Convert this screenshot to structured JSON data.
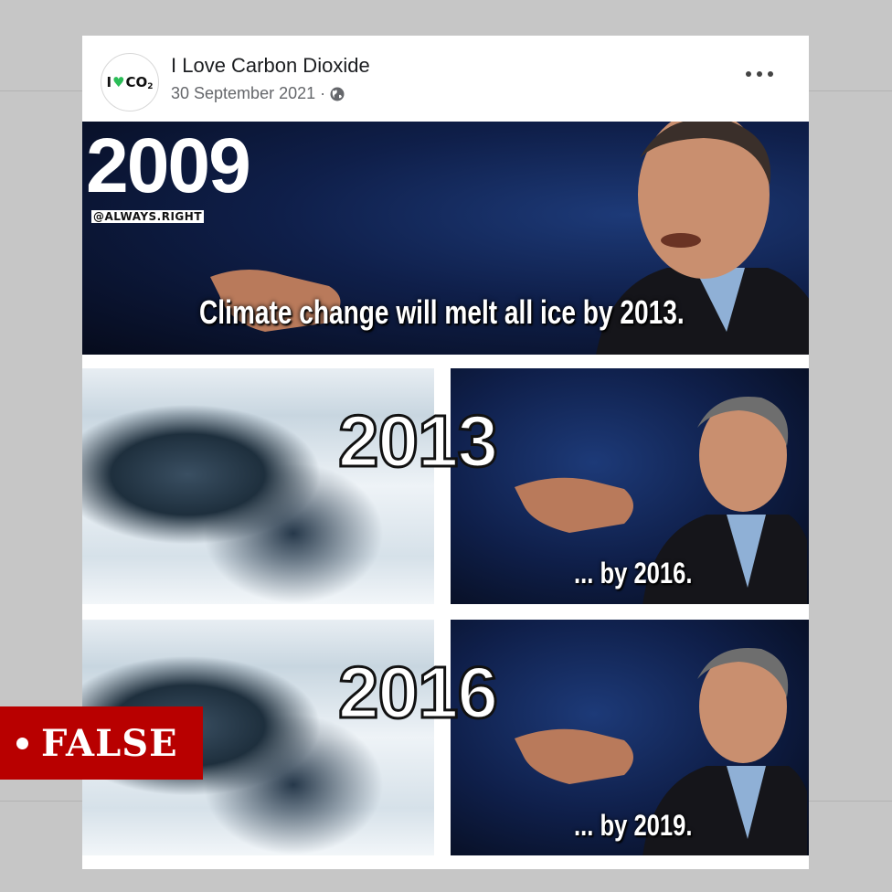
{
  "post": {
    "avatar_text": "I",
    "avatar_co2": "CO",
    "avatar_sub": "2",
    "page_name": "I Love Carbon Dioxide",
    "date": "30 September 2021 ·",
    "privacy_icon": "globe-icon",
    "more_icon": "more-options-icon"
  },
  "meme": {
    "top_year": "2009",
    "handle": "@ALWAYS.RIGHT",
    "top_quote": "Climate change will melt all ice by 2013.",
    "mid_year": "2013",
    "mid_caption": "... by 2016.",
    "bottom_year": "2016",
    "bottom_caption": "... by 2019."
  },
  "badge": {
    "label": "FALSE",
    "color": "#b80000"
  },
  "colors": {
    "background": "#c6c6c6",
    "avatar_heart": "#2bbd57"
  }
}
